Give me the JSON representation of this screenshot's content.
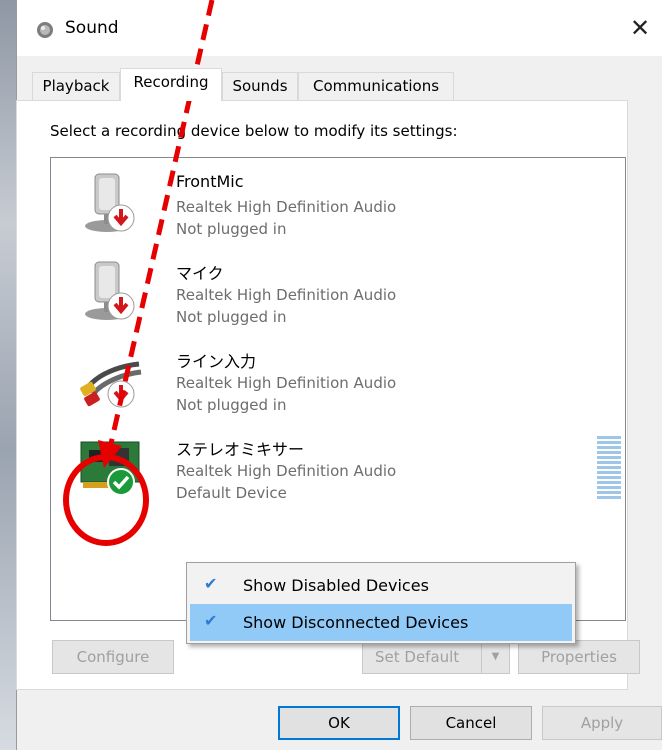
{
  "window": {
    "title": "Sound",
    "close_glyph": "✕"
  },
  "tabs": [
    {
      "label": "Playback",
      "active": false
    },
    {
      "label": "Recording",
      "active": true
    },
    {
      "label": "Sounds",
      "active": false
    },
    {
      "label": "Communications",
      "active": false
    }
  ],
  "instruction": "Select a recording device below to modify its settings:",
  "devices": [
    {
      "name": "FrontMic",
      "driver": "Realtek High Definition Audio",
      "status": "Not plugged in",
      "icon": "microphone-icon",
      "badge": "unplugged-badge-icon"
    },
    {
      "name": "マイク",
      "driver": "Realtek High Definition Audio",
      "status": "Not plugged in",
      "icon": "microphone-icon",
      "badge": "unplugged-badge-icon"
    },
    {
      "name": "ライン入力",
      "driver": "Realtek High Definition Audio",
      "status": "Not plugged in",
      "icon": "line-in-cable-icon",
      "badge": "unplugged-badge-icon"
    },
    {
      "name": "ステレオミキサー",
      "driver": "Realtek High Definition Audio",
      "status": "Default Device",
      "icon": "sound-card-icon",
      "badge": "default-check-badge-icon"
    }
  ],
  "context_menu": {
    "items": [
      {
        "label": "Show Disabled Devices",
        "checked": true,
        "highlighted": false
      },
      {
        "label": "Show Disconnected Devices",
        "checked": true,
        "highlighted": true
      }
    ],
    "check_glyph": "✔"
  },
  "buttons": {
    "configure": "Configure",
    "set_default": "Set Default",
    "split_arrow": "▼",
    "properties": "Properties",
    "ok": "OK",
    "cancel": "Cancel",
    "apply": "Apply"
  },
  "colors": {
    "accent": "#0078d7",
    "annotation_red": "#e60000",
    "unplugged_red": "#d4161c",
    "default_green": "#1a9a3a",
    "menu_highlight": "#91c9f7"
  }
}
